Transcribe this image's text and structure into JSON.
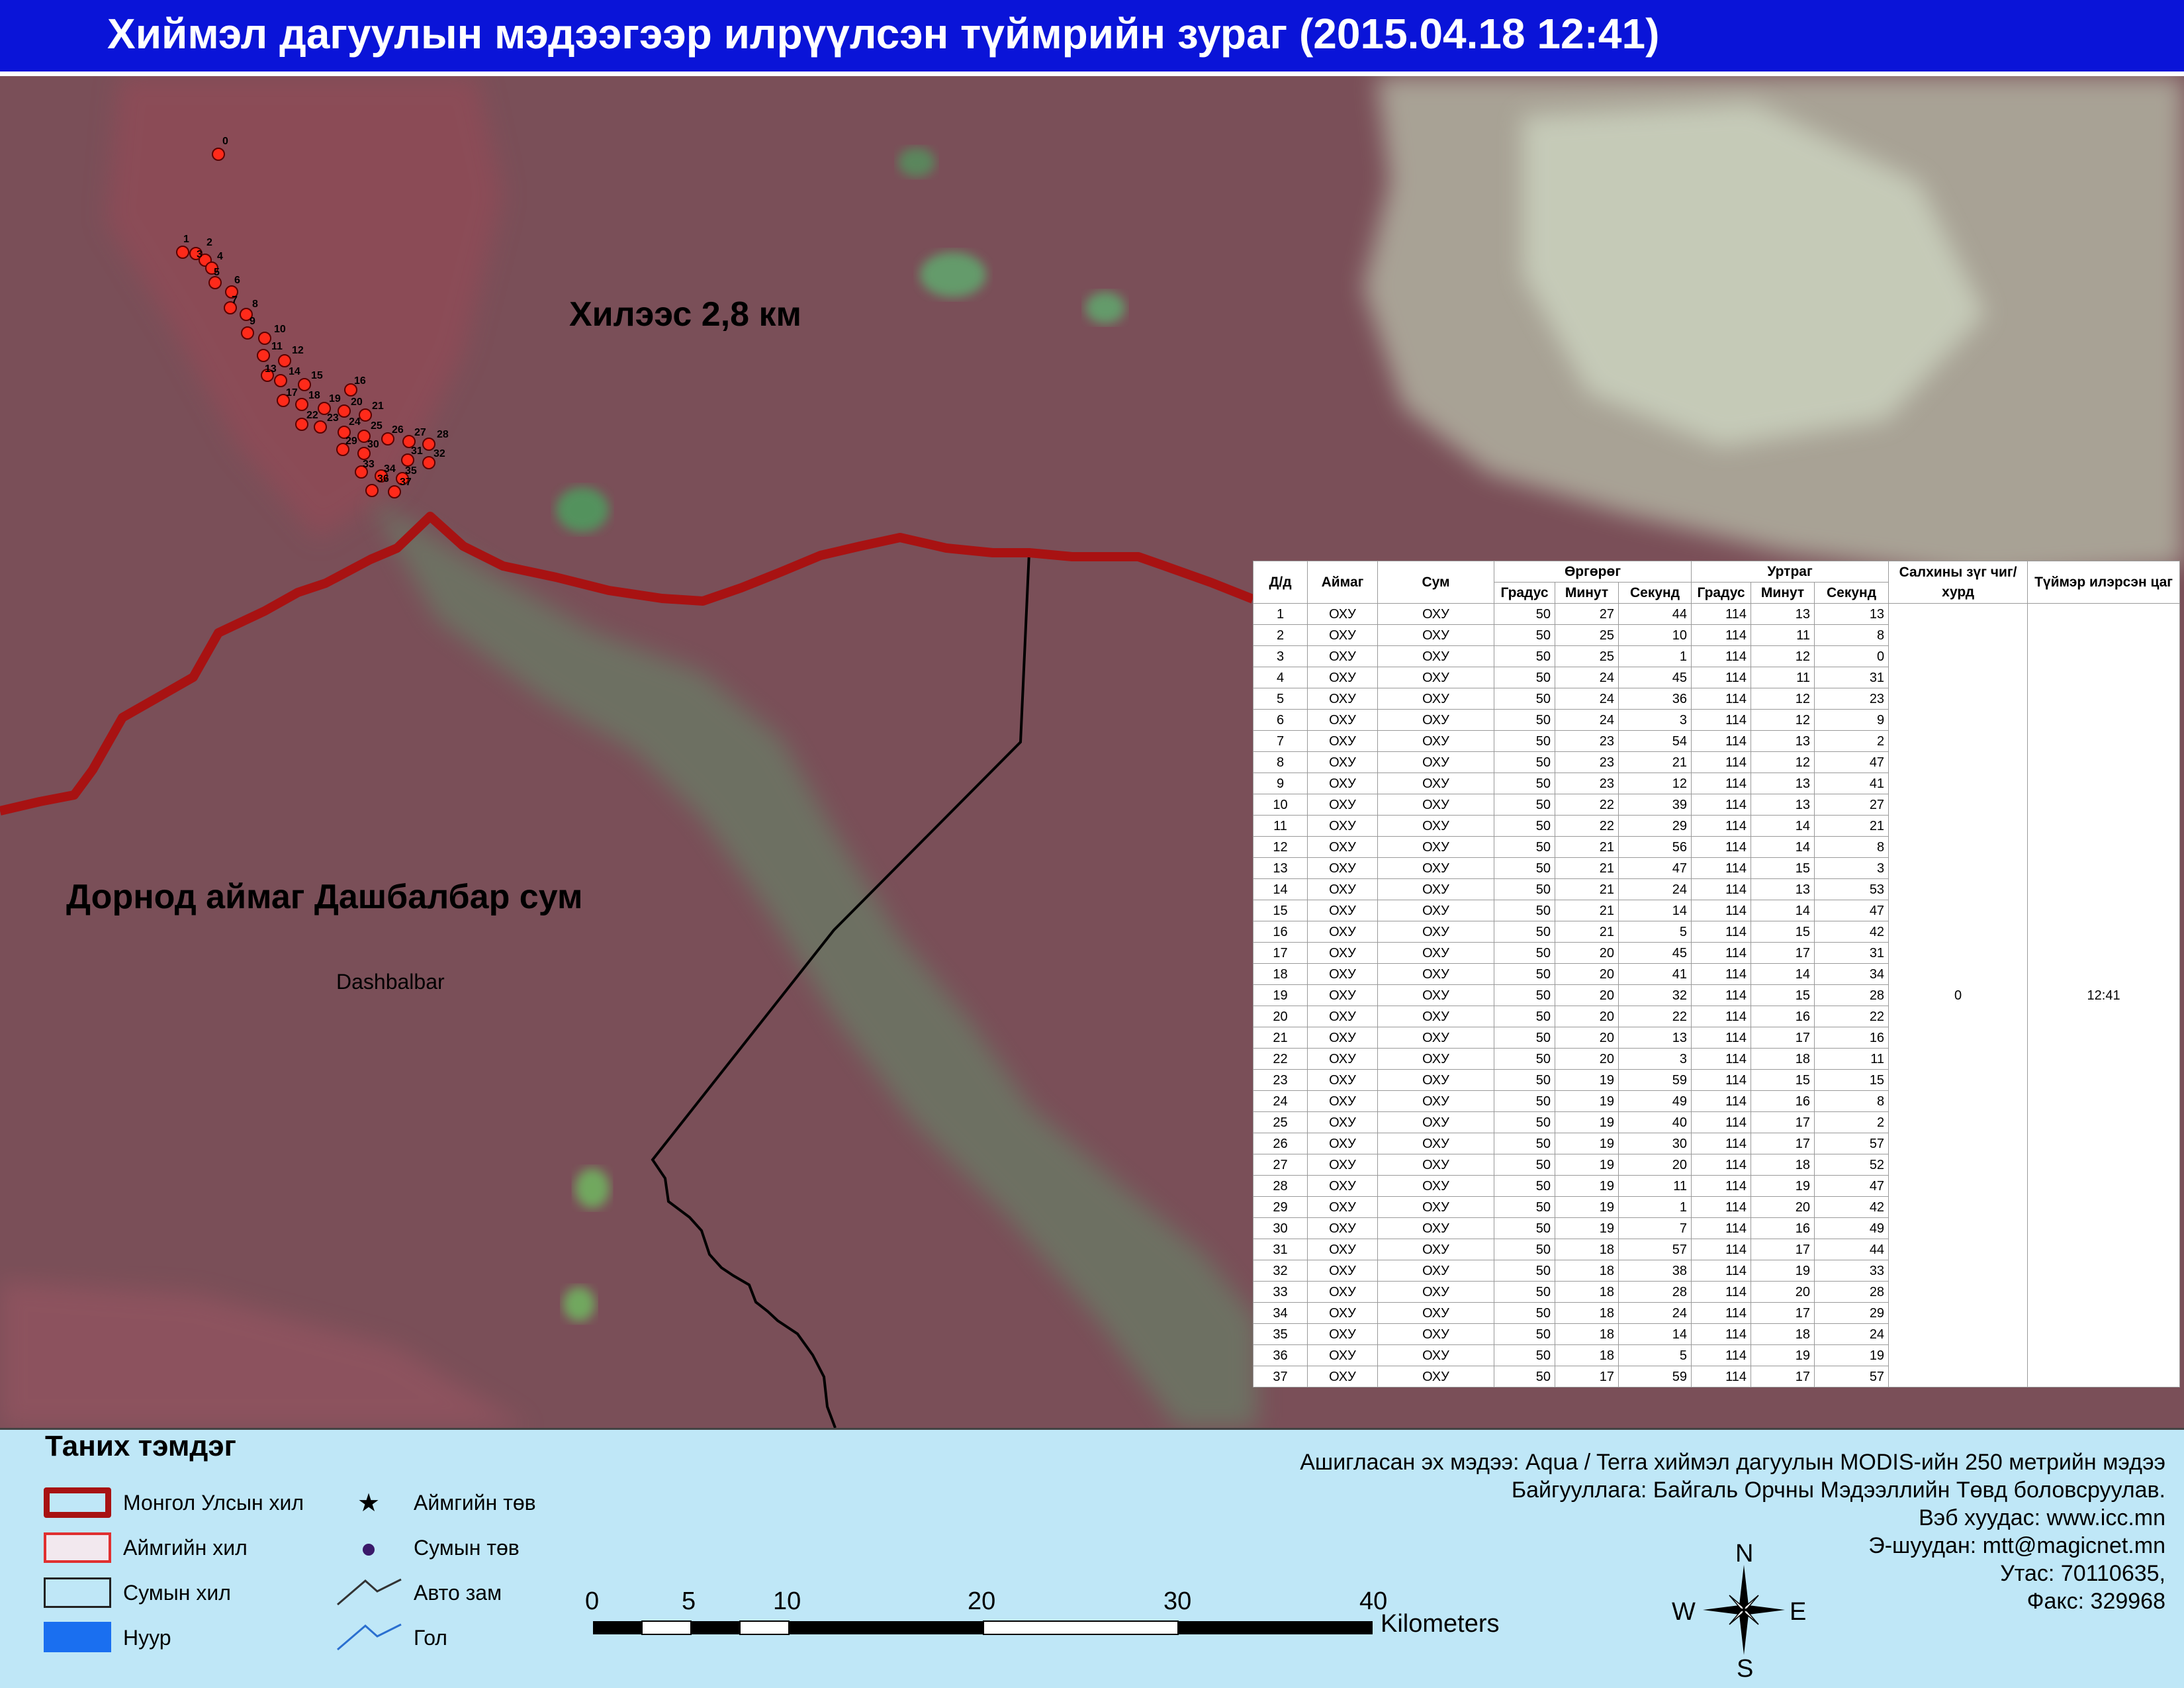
{
  "title": "Хиймэл дагуулын мэдээгээр илрүүлсэн түймрийн зураг  (2015.04.18 12:41)",
  "map": {
    "distance_label": "Хилээс 2,8 км",
    "province_label": "Дорнод  аймаг Дашбалбар сум",
    "town_label": "Dashbalbar",
    "colors": {
      "terrain": "#7a4f58",
      "vegetation": "#5f9a70",
      "cloud": "#cfe6c8",
      "national_border": "#a81212",
      "fire_point": "#ff2a1a",
      "soum_border": "#000000"
    }
  },
  "fire_labels": [
    "0",
    "1",
    "2",
    "3",
    "4",
    "5",
    "6",
    "7",
    "8",
    "9",
    "10",
    "11",
    "12",
    "13",
    "14",
    "15",
    "16",
    "17",
    "18",
    "19",
    "20",
    "21",
    "22",
    "23",
    "24",
    "25",
    "26",
    "27",
    "28",
    "29",
    "30",
    "31",
    "32",
    "33",
    "34",
    "35",
    "36",
    "37"
  ],
  "table": {
    "headers": {
      "no": "Д/д",
      "aimag": "Аймаг",
      "sum": "Сум",
      "lat": "Өргөрөг",
      "lon": "Уртраг",
      "deg": "Градус",
      "min": "Минут",
      "sec": "Секунд",
      "wind": "Салхины зүг чиг/хурд",
      "time": "Түймэр илэрсэн цаг"
    },
    "wind_value": "0",
    "time_value": "12:41",
    "rows": [
      [
        "1",
        "ОХУ",
        "ОХУ",
        "50",
        "27",
        "44",
        "114",
        "13",
        "13"
      ],
      [
        "2",
        "ОХУ",
        "ОХУ",
        "50",
        "25",
        "10",
        "114",
        "11",
        "8"
      ],
      [
        "3",
        "ОХУ",
        "ОХУ",
        "50",
        "25",
        "1",
        "114",
        "12",
        "0"
      ],
      [
        "4",
        "ОХУ",
        "ОХУ",
        "50",
        "24",
        "45",
        "114",
        "11",
        "31"
      ],
      [
        "5",
        "ОХУ",
        "ОХУ",
        "50",
        "24",
        "36",
        "114",
        "12",
        "23"
      ],
      [
        "6",
        "ОХУ",
        "ОХУ",
        "50",
        "24",
        "3",
        "114",
        "12",
        "9"
      ],
      [
        "7",
        "ОХУ",
        "ОХУ",
        "50",
        "23",
        "54",
        "114",
        "13",
        "2"
      ],
      [
        "8",
        "ОХУ",
        "ОХУ",
        "50",
        "23",
        "21",
        "114",
        "12",
        "47"
      ],
      [
        "9",
        "ОХУ",
        "ОХУ",
        "50",
        "23",
        "12",
        "114",
        "13",
        "41"
      ],
      [
        "10",
        "ОХУ",
        "ОХУ",
        "50",
        "22",
        "39",
        "114",
        "13",
        "27"
      ],
      [
        "11",
        "ОХУ",
        "ОХУ",
        "50",
        "22",
        "29",
        "114",
        "14",
        "21"
      ],
      [
        "12",
        "ОХУ",
        "ОХУ",
        "50",
        "21",
        "56",
        "114",
        "14",
        "8"
      ],
      [
        "13",
        "ОХУ",
        "ОХУ",
        "50",
        "21",
        "47",
        "114",
        "15",
        "3"
      ],
      [
        "14",
        "ОХУ",
        "ОХУ",
        "50",
        "21",
        "24",
        "114",
        "13",
        "53"
      ],
      [
        "15",
        "ОХУ",
        "ОХУ",
        "50",
        "21",
        "14",
        "114",
        "14",
        "47"
      ],
      [
        "16",
        "ОХУ",
        "ОХУ",
        "50",
        "21",
        "5",
        "114",
        "15",
        "42"
      ],
      [
        "17",
        "ОХУ",
        "ОХУ",
        "50",
        "20",
        "45",
        "114",
        "17",
        "31"
      ],
      [
        "18",
        "ОХУ",
        "ОХУ",
        "50",
        "20",
        "41",
        "114",
        "14",
        "34"
      ],
      [
        "19",
        "ОХУ",
        "ОХУ",
        "50",
        "20",
        "32",
        "114",
        "15",
        "28"
      ],
      [
        "20",
        "ОХУ",
        "ОХУ",
        "50",
        "20",
        "22",
        "114",
        "16",
        "22"
      ],
      [
        "21",
        "ОХУ",
        "ОХУ",
        "50",
        "20",
        "13",
        "114",
        "17",
        "16"
      ],
      [
        "22",
        "ОХУ",
        "ОХУ",
        "50",
        "20",
        "3",
        "114",
        "18",
        "11"
      ],
      [
        "23",
        "ОХУ",
        "ОХУ",
        "50",
        "19",
        "59",
        "114",
        "15",
        "15"
      ],
      [
        "24",
        "ОХУ",
        "ОХУ",
        "50",
        "19",
        "49",
        "114",
        "16",
        "8"
      ],
      [
        "25",
        "ОХУ",
        "ОХУ",
        "50",
        "19",
        "40",
        "114",
        "17",
        "2"
      ],
      [
        "26",
        "ОХУ",
        "ОХУ",
        "50",
        "19",
        "30",
        "114",
        "17",
        "57"
      ],
      [
        "27",
        "ОХУ",
        "ОХУ",
        "50",
        "19",
        "20",
        "114",
        "18",
        "52"
      ],
      [
        "28",
        "ОХУ",
        "ОХУ",
        "50",
        "19",
        "11",
        "114",
        "19",
        "47"
      ],
      [
        "29",
        "ОХУ",
        "ОХУ",
        "50",
        "19",
        "1",
        "114",
        "20",
        "42"
      ],
      [
        "30",
        "ОХУ",
        "ОХУ",
        "50",
        "19",
        "7",
        "114",
        "16",
        "49"
      ],
      [
        "31",
        "ОХУ",
        "ОХУ",
        "50",
        "18",
        "57",
        "114",
        "17",
        "44"
      ],
      [
        "32",
        "ОХУ",
        "ОХУ",
        "50",
        "18",
        "38",
        "114",
        "19",
        "33"
      ],
      [
        "33",
        "ОХУ",
        "ОХУ",
        "50",
        "18",
        "28",
        "114",
        "20",
        "28"
      ],
      [
        "34",
        "ОХУ",
        "ОХУ",
        "50",
        "18",
        "24",
        "114",
        "17",
        "29"
      ],
      [
        "35",
        "ОХУ",
        "ОХУ",
        "50",
        "18",
        "14",
        "114",
        "18",
        "24"
      ],
      [
        "36",
        "ОХУ",
        "ОХУ",
        "50",
        "18",
        "5",
        "114",
        "19",
        "19"
      ],
      [
        "37",
        "ОХУ",
        "ОХУ",
        "50",
        "17",
        "59",
        "114",
        "17",
        "57"
      ]
    ]
  },
  "legend": {
    "title": "Таних тэмдэг",
    "national_border": "Монгол Улсын хил",
    "aimag_border": "Аймгийн хил",
    "sum_border": "Сумын хил",
    "lake": "Нуур",
    "aimag_center": "Аймгийн төв",
    "sum_center": "Сумын төв",
    "road": "Авто зам",
    "river": "Гол",
    "colors": {
      "national_border": "#a81212",
      "aimag_border": "#e03030",
      "lake": "#1a6ff0",
      "road": "#333333",
      "river": "#2a6fd0",
      "sum_center": "#3a1a6a"
    }
  },
  "credits": {
    "source": "Ашигласан эх мэдээ: Aqua / Terra хиймэл дагуулын MODIS-ийн 250 метрийн мэдээ",
    "org": "Байгууллага: Байгаль Орчны Мэдээллийн Төвд боловсруулав.",
    "web": "Вэб хуудас: www.icc.mn",
    "email": "Э-шуудан: mtt@magicnet.mn",
    "phone": "Утас: 70110635,",
    "fax": "Факс: 329968"
  },
  "scale": {
    "ticks": [
      "0",
      "5",
      "10",
      "20",
      "30",
      "40"
    ],
    "unit": "Kilometers"
  },
  "compass": {
    "n": "N",
    "s": "S",
    "e": "E",
    "w": "W"
  }
}
